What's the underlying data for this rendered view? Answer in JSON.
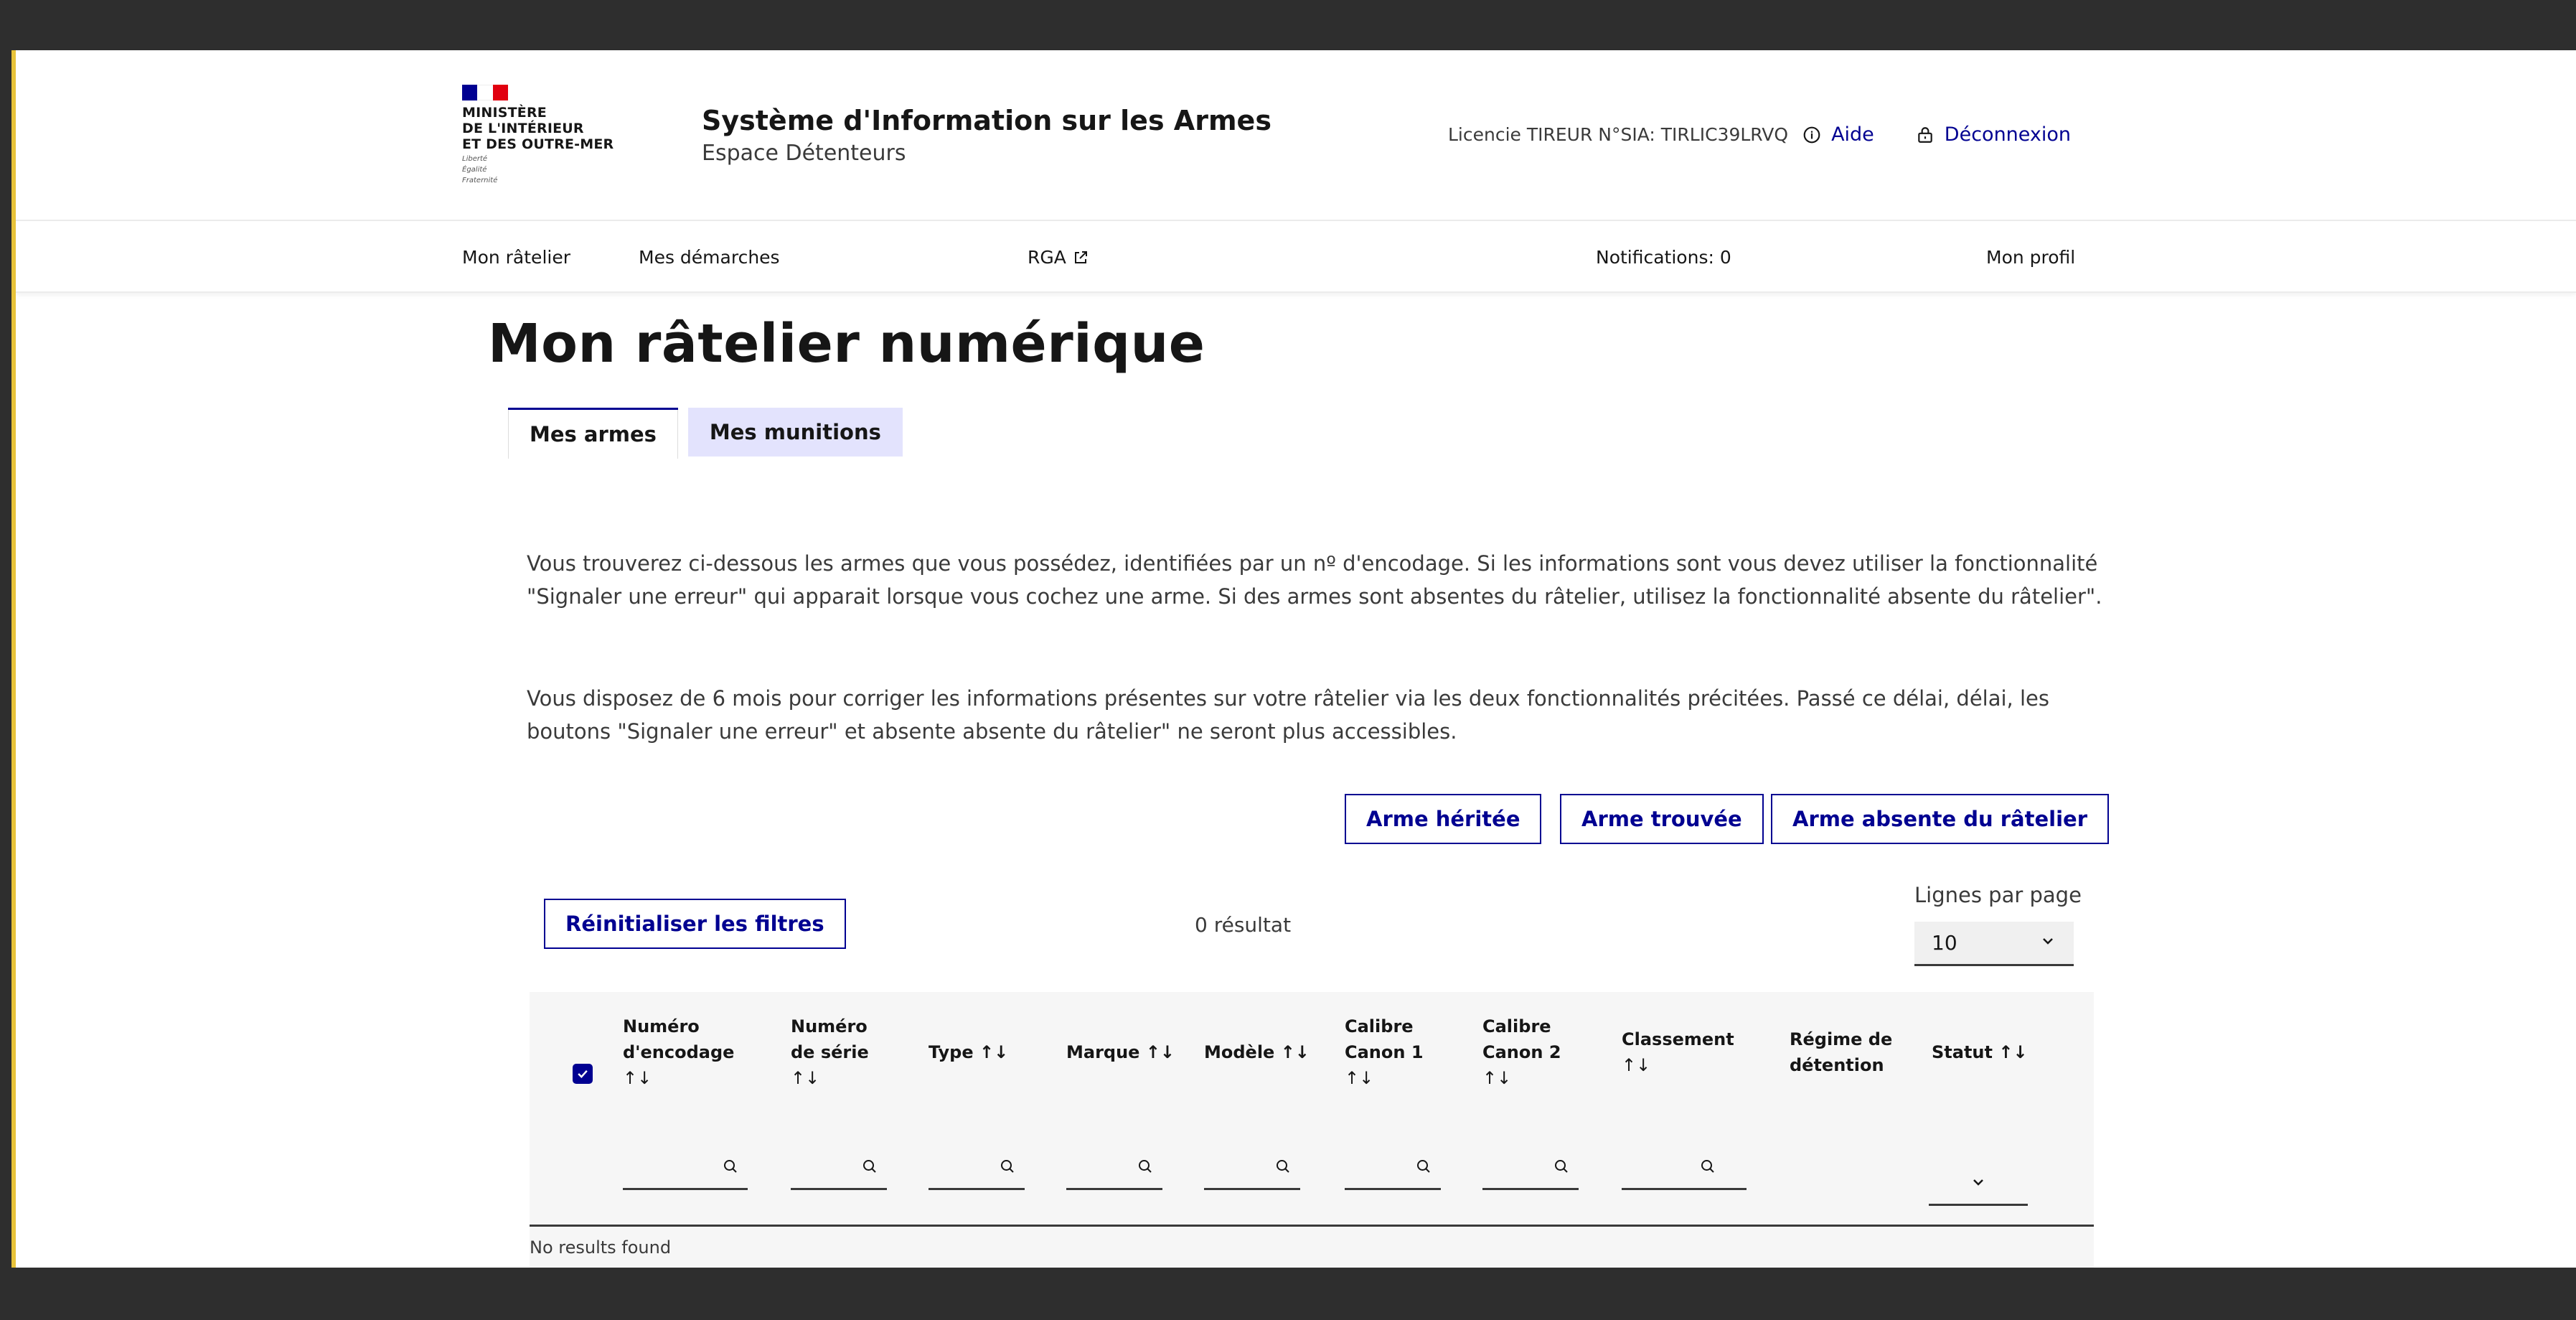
{
  "header": {
    "logo_lines": [
      "MINISTÈRE",
      "DE L'INTÉRIEUR",
      "ET DES OUTRE-MER"
    ],
    "motto_lines": [
      "Liberté",
      "Égalité",
      "Fraternité"
    ],
    "site_title": "Système d'Information sur les Armes",
    "site_subtitle": "Espace Détenteurs",
    "license": "Licencie TIREUR N°SIA: TIRLIC39LRVQ",
    "help_label": "Aide",
    "logout_label": "Déconnexion"
  },
  "nav": {
    "items": [
      "Mon râtelier",
      "Mes démarches",
      "RGA",
      "Notifications: 0",
      "Mon profil"
    ]
  },
  "page_title": "Mon râtelier numérique",
  "tabs": [
    "Mes armes",
    "Mes munitions"
  ],
  "paragraphs": [
    "Vous trouverez ci-dessous les armes que vous possédez, identifiées par un nº d'encodage. Si les informations sont vous devez utiliser la fonctionnalité \"Signaler une erreur\" qui apparait lorsque vous cochez une arme. Si des armes sont absentes du râtelier, utilisez la fonctionnalité absente du râtelier\".",
    "Vous disposez de 6 mois pour corriger les informations présentes sur votre râtelier via les deux fonctionnalités précitées. Passé ce délai, délai, les boutons \"Signaler une erreur\" et absente absente du râtelier\" ne seront plus accessibles."
  ],
  "actions": {
    "inherited": "Arme héritée",
    "found": "Arme trouvée",
    "absent": "Arme absente du râtelier",
    "reset_filters": "Réinitialiser les filtres"
  },
  "results_label": "0 résultat",
  "rows_per_page": {
    "label": "Lignes par page",
    "value": "10"
  },
  "table": {
    "columns": [
      {
        "lines": [
          "Numéro",
          "d'encodage"
        ],
        "sort": "↑↓"
      },
      {
        "lines": [
          "Numéro",
          "de série"
        ],
        "sort": "↑↓"
      },
      {
        "lines": [
          "Type ↑↓"
        ],
        "sort": ""
      },
      {
        "lines": [
          "Marque ↑↓"
        ],
        "sort": ""
      },
      {
        "lines": [
          "Modèle ↑↓"
        ],
        "sort": ""
      },
      {
        "lines": [
          "Calibre",
          "Canon 1"
        ],
        "sort": "↑↓"
      },
      {
        "lines": [
          "Calibre",
          "Canon 2"
        ],
        "sort": "↑↓"
      },
      {
        "lines": [
          "Classement"
        ],
        "sort": "↑↓"
      },
      {
        "lines": [
          "Régime de",
          "détention"
        ],
        "sort": ""
      },
      {
        "lines": [
          "Statut ↑↓"
        ],
        "sort": ""
      }
    ],
    "empty_message": "No results found"
  },
  "colors": {
    "primary": "#000091",
    "tab_inactive_bg": "#e3e3fd",
    "flag_blue": "#000091",
    "flag_red": "#e1000f"
  }
}
